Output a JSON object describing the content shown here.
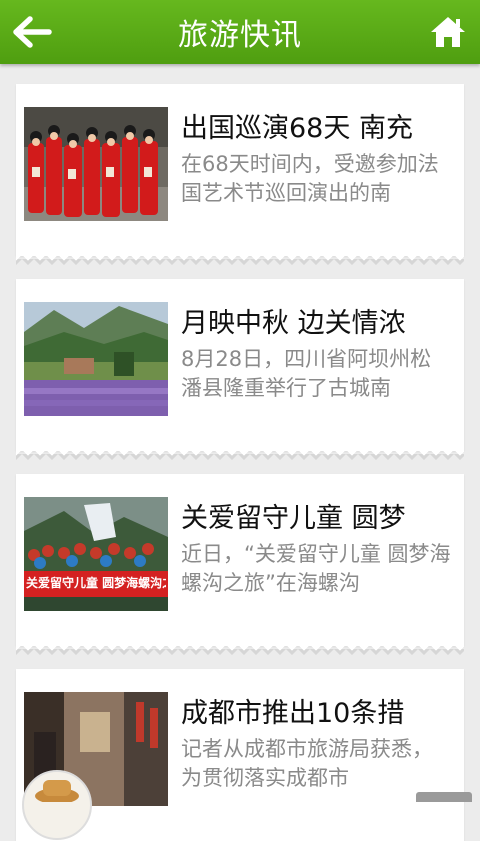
{
  "header": {
    "title": "旅游快讯",
    "back_icon": "arrow-left-icon",
    "home_icon": "home-icon",
    "bar_color": "#5aad17"
  },
  "news": [
    {
      "headline": "出国巡演68天 南充",
      "summary": "在68天时间内，受邀参加法国艺术节巡回演出的南",
      "image": "performers-in-red-costumes-photo"
    },
    {
      "headline": "月映中秋 边关情浓",
      "summary": "8月28日，四川省阿坝州松潘县隆重举行了古城南",
      "image": "lavender-field-mountain-photo"
    },
    {
      "headline": "关爱留守儿童 圆梦",
      "summary": "近日，“关爱留守儿童 圆梦海螺沟之旅”在海螺沟",
      "image": "children-group-banner-photo",
      "banner_text": "关爱留守儿童 圆梦海螺沟之旅"
    },
    {
      "headline": "成都市推出10条措",
      "summary": "记者从成都市旅游局获悉，为贯彻落实成都市",
      "image": "old-street-building-photo"
    }
  ]
}
